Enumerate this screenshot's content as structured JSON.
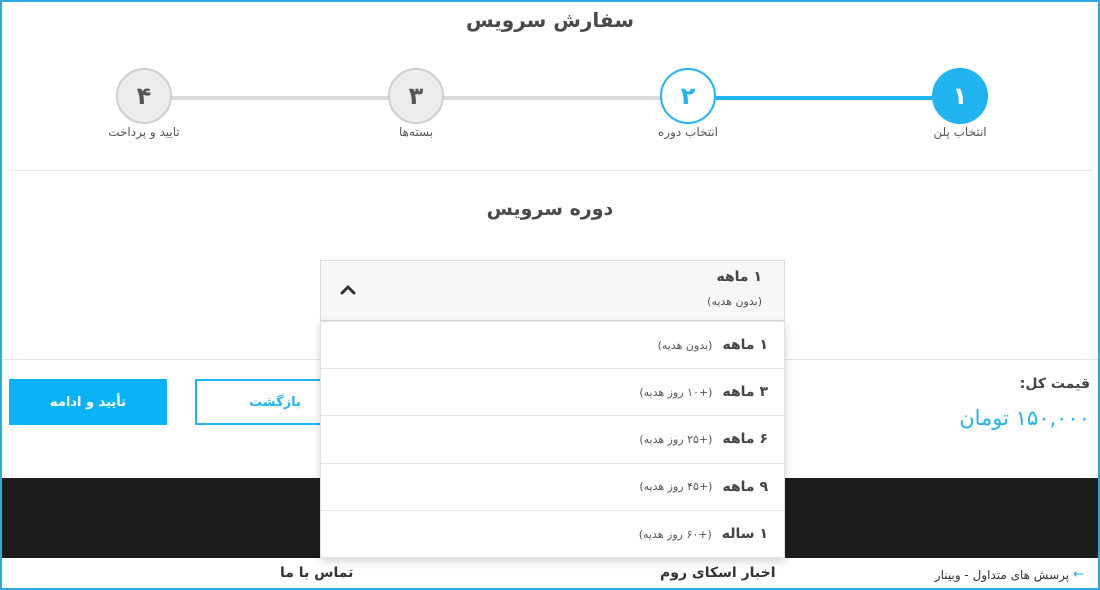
{
  "page_title": "سفارش سرویس",
  "steps": [
    {
      "number": "۱",
      "label": "انتخاب پلن",
      "state": "done"
    },
    {
      "number": "۲",
      "label": "انتخاب دوره",
      "state": "current"
    },
    {
      "number": "۳",
      "label": "بسته‌ها",
      "state": "pending"
    },
    {
      "number": "۴",
      "label": "تایید و پرداخت",
      "state": "pending"
    }
  ],
  "section_title": "دوره سرویس",
  "period_select": {
    "selected_main": "۱ ماهه",
    "selected_sub": "(بدون هدیه)",
    "options": [
      {
        "main": "۱ ماهه",
        "sub": "(بدون هدیه)"
      },
      {
        "main": "۳ ماهه",
        "sub": "(+۱۰ روز هدیه)"
      },
      {
        "main": "۶ ماهه",
        "sub": "(+۲۵ روز هدیه)"
      },
      {
        "main": "۹ ماهه",
        "sub": "(+۴۵ روز هدیه)"
      },
      {
        "main": "۱ ساله",
        "sub": "(+۶۰ روز هدیه)"
      }
    ]
  },
  "actions": {
    "confirm_label": "تأیید و ادامه",
    "back_label": "بازگشت"
  },
  "price": {
    "label": "قیمت کل:",
    "value": "۱۵۰,۰۰۰ تومان"
  },
  "footer": {
    "contact_heading": "تماس با ما",
    "news_heading": "اخبار اسکای روم",
    "faq_link": "پرسش های متداول - وبینار"
  },
  "colors": {
    "accent": "#1fb4f0",
    "footer_bg": "#1d1d1d"
  }
}
